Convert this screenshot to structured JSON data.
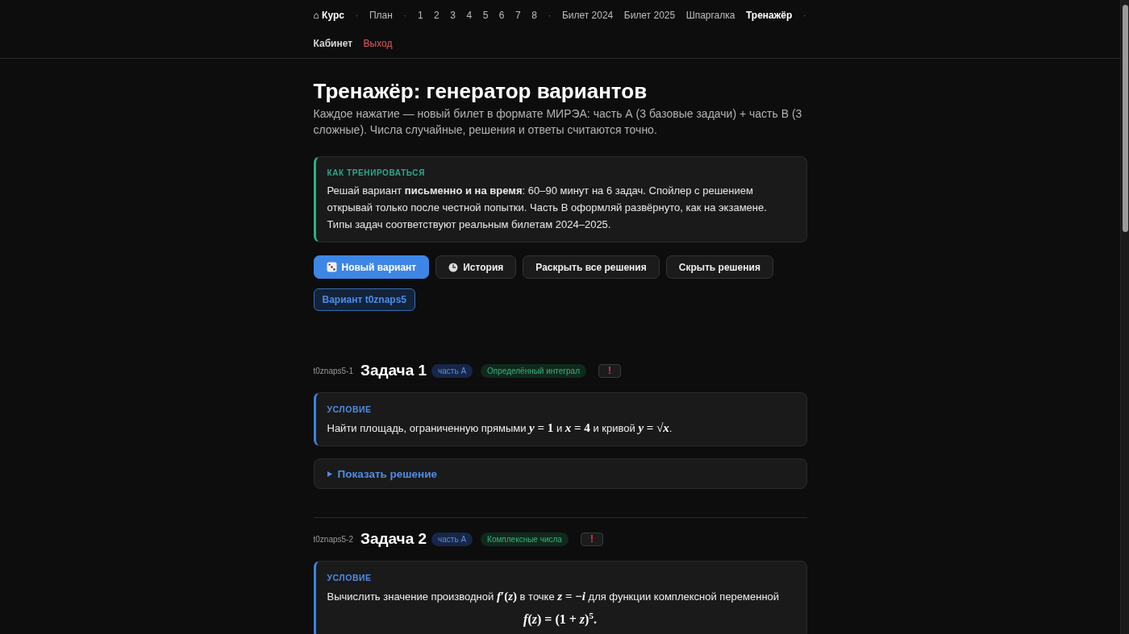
{
  "nav": {
    "brand": "⌂ Курс",
    "items": [
      {
        "kind": "sep",
        "label": "·",
        "selected": false
      },
      {
        "kind": "link",
        "label": "План",
        "selected": false
      },
      {
        "kind": "sep",
        "label": "·",
        "selected": false
      },
      {
        "kind": "link",
        "label": "1",
        "selected": false
      },
      {
        "kind": "link",
        "label": "2",
        "selected": false
      },
      {
        "kind": "link",
        "label": "3",
        "selected": false
      },
      {
        "kind": "link",
        "label": "4",
        "selected": false
      },
      {
        "kind": "link",
        "label": "5",
        "selected": false
      },
      {
        "kind": "link",
        "label": "6",
        "selected": false
      },
      {
        "kind": "link",
        "label": "7",
        "selected": false
      },
      {
        "kind": "link",
        "label": "8",
        "selected": false
      },
      {
        "kind": "sep",
        "label": "·",
        "selected": false
      },
      {
        "kind": "link",
        "label": "Билет 2024",
        "selected": false
      },
      {
        "kind": "link",
        "label": "Билет 2025",
        "selected": false
      },
      {
        "kind": "link",
        "label": "Шпаргалка",
        "selected": false
      },
      {
        "kind": "link",
        "label": "Тренажёр",
        "selected": true
      },
      {
        "kind": "sep",
        "label": "·",
        "selected": false
      },
      {
        "kind": "account",
        "label": "Кабинет",
        "selected": false
      },
      {
        "kind": "logout",
        "label": "Выход",
        "selected": false
      }
    ]
  },
  "header": {
    "title": "Тренажёр: генератор вариантов",
    "intro": "Каждое нажатие — новый билет в формате МИРЭА: часть А (3 базовые задачи) + часть В (3 сложные). Числа случайные, решения и ответы считаются точно."
  },
  "tip": {
    "label": "КАК ТРЕНИРОВАТЬСЯ",
    "text": "Решай вариант **письменно и на время**: 60–90 минут на 6 задач. Спойлер с решением открывай только после честной попытки. Часть В оформляй развёрнуто, как на экзамене. Типы задач соответствуют реальным билетам 2024–2025."
  },
  "actions": [
    {
      "kind": "primary",
      "label": "Новый вариант"
    },
    {
      "kind": "history",
      "label": "История"
    },
    {
      "kind": "plain",
      "label": "Раскрыть все решения"
    },
    {
      "kind": "plain",
      "label": "Скрыть решения"
    }
  ],
  "variant": {
    "label": "Вариант t0znaps5"
  },
  "tasks": [
    {
      "code": "t0znaps5-1",
      "title": "Задача 1",
      "tags": [
        {
          "kind": "part",
          "label": "часть А"
        },
        {
          "kind": "topic",
          "label": "Определённый интеграл"
        }
      ],
      "flag": "!",
      "condition": {
        "label": "УСЛОВИЕ",
        "segments": [
          {
            "kind": "text",
            "text": "Найти площадь, ограниченную прямыми "
          },
          {
            "kind": "math",
            "text": "*y* = 1"
          },
          {
            "kind": "text",
            "text": " и "
          },
          {
            "kind": "math",
            "text": "*x* = 4"
          },
          {
            "kind": "text",
            "text": " и кривой "
          },
          {
            "kind": "math",
            "text": "*y* = √*x*"
          },
          {
            "kind": "text",
            "text": "."
          }
        ]
      },
      "solution": {
        "label": "Показать решение",
        "expanded": false
      }
    },
    {
      "code": "t0znaps5-2",
      "title": "Задача 2",
      "tags": [
        {
          "kind": "part",
          "label": "часть А"
        },
        {
          "kind": "topic",
          "label": "Комплексные числа"
        }
      ],
      "flag": "!",
      "condition": {
        "label": "УСЛОВИЕ",
        "segments": [
          {
            "kind": "text",
            "text": "Вычислить значение производной "
          },
          {
            "kind": "math",
            "text": "*f*′(*z*)"
          },
          {
            "kind": "text",
            "text": " в точке "
          },
          {
            "kind": "math",
            "text": "*z* = −*i*"
          },
          {
            "kind": "text",
            "text": " для функции комплексной переменной"
          }
        ],
        "display": "*f*(*z*) = (1 + *z*)$^{5}$."
      }
    }
  ]
}
